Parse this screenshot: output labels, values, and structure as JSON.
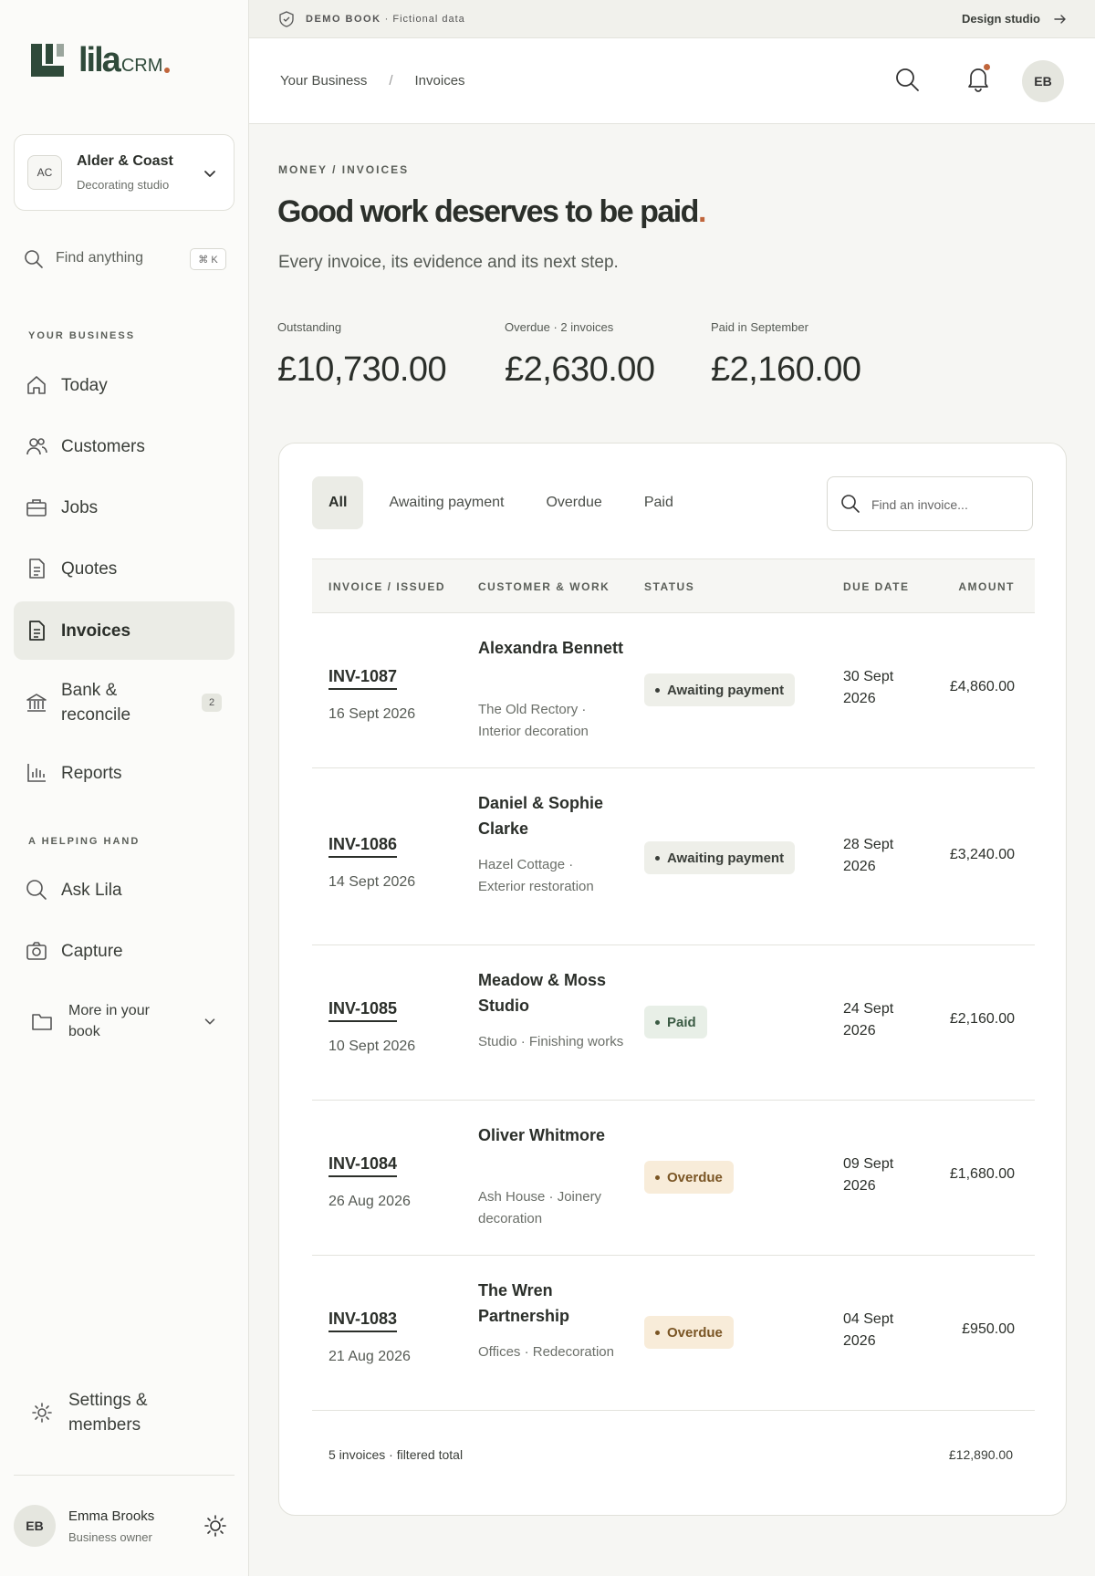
{
  "brand": {
    "word": "lila",
    "suffix": "CRM"
  },
  "workspace": {
    "initials": "AC",
    "name": "Alder & Coast",
    "subtitle": "Decorating studio"
  },
  "find": {
    "label": "Find anything",
    "shortcut": "⌘ K"
  },
  "sections": {
    "business": "YOUR BUSINESS",
    "helping": "A HELPING HAND"
  },
  "nav": {
    "today": "Today",
    "customers": "Customers",
    "jobs": "Jobs",
    "quotes": "Quotes",
    "invoices": "Invoices",
    "bank": "Bank & reconcile",
    "bank_count": "2",
    "reports": "Reports",
    "ask": "Ask Lila",
    "capture": "Capture",
    "more": "More in your book",
    "settings": "Settings & members"
  },
  "user": {
    "initials": "EB",
    "name": "Emma Brooks",
    "role": "Business owner"
  },
  "banner": {
    "tag": "DEMO BOOK",
    "text": "· Fictional data",
    "studio": "Design studio"
  },
  "breadcrumbs": {
    "root": "Your Business",
    "sep": "/",
    "current": "Invoices"
  },
  "topbar": {
    "avatar": "EB"
  },
  "page": {
    "eyebrow": "MONEY / INVOICES",
    "headline": "Good work deserves to be paid",
    "headline_dot": ".",
    "lede": "Every invoice, its evidence and its next step."
  },
  "stats": [
    {
      "label": "Outstanding",
      "value": "£10,730.00"
    },
    {
      "label": "Overdue · 2 invoices",
      "value": "£2,630.00"
    },
    {
      "label": "Paid in September",
      "value": "£2,160.00"
    }
  ],
  "filters": [
    "All",
    "Awaiting payment",
    "Overdue",
    "Paid"
  ],
  "search": {
    "placeholder": "Find an invoice..."
  },
  "columns": {
    "invoice": "INVOICE / ISSUED",
    "customer": "CUSTOMER & WORK",
    "status": "STATUS",
    "due": "DUE DATE",
    "amount": "AMOUNT"
  },
  "colors": {
    "awaiting_bg": "#eeefe9",
    "awaiting_fg": "#3a3e39",
    "paid_bg": "#e8efe7",
    "paid_fg": "#3b5b44",
    "overdue_bg": "#f8ecd9",
    "overdue_fg": "#7a5524"
  },
  "invoices": [
    {
      "id": "INV-1087",
      "issued": "16 Sept 2026",
      "customer": "Alexandra Bennett",
      "work": "The Old Rectory · Interior decoration",
      "status": "Awaiting payment",
      "status_type": "awaiting",
      "due": "30 Sept 2026",
      "amount": "£4,860.00"
    },
    {
      "id": "INV-1086",
      "issued": "14 Sept 2026",
      "customer": "Daniel & Sophie Clarke",
      "work": "Hazel Cottage · Exterior restoration",
      "status": "Awaiting payment",
      "status_type": "awaiting",
      "due": "28 Sept 2026",
      "amount": "£3,240.00"
    },
    {
      "id": "INV-1085",
      "issued": "10 Sept 2026",
      "customer": "Meadow & Moss Studio",
      "work": "Studio · Finishing works",
      "status": "Paid",
      "status_type": "paid",
      "due": "24 Sept 2026",
      "amount": "£2,160.00"
    },
    {
      "id": "INV-1084",
      "issued": "26 Aug 2026",
      "customer": "Oliver Whitmore",
      "work": "Ash House · Joinery decoration",
      "status": "Overdue",
      "status_type": "overdue",
      "due": "09 Sept 2026",
      "amount": "£1,680.00"
    },
    {
      "id": "INV-1083",
      "issued": "21 Aug 2026",
      "customer": "The Wren Partnership",
      "work": "Offices · Redecoration",
      "status": "Overdue",
      "status_type": "overdue",
      "due": "04 Sept 2026",
      "amount": "£950.00"
    }
  ],
  "footer": {
    "summary": "5 invoices · filtered total",
    "total": "£12,890.00"
  }
}
